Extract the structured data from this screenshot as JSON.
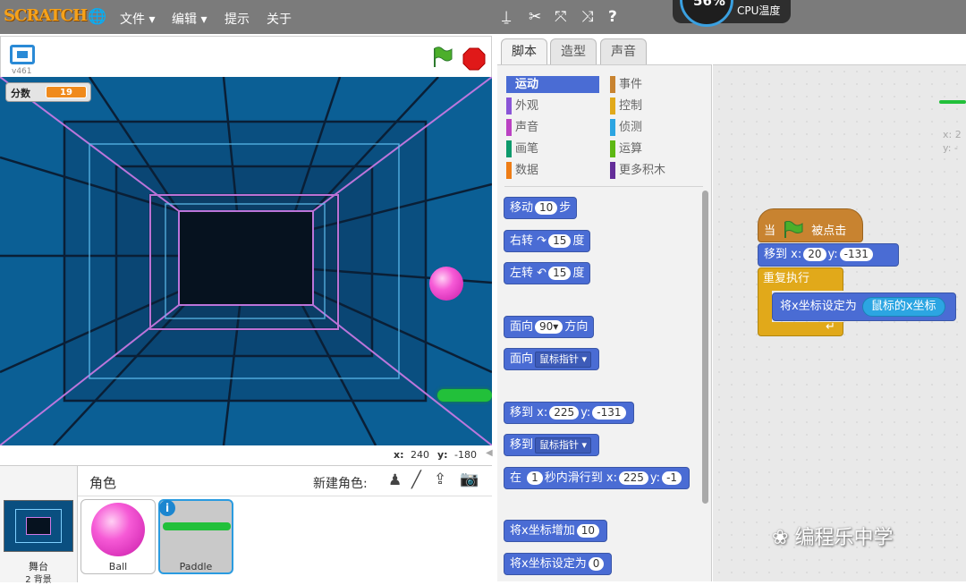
{
  "menubar": {
    "logo": "SCRATCH",
    "menu": [
      "文件 ▾",
      "编辑 ▾",
      "提示",
      "关于"
    ],
    "tools": [
      "stamp-icon",
      "scissors-icon",
      "grow-icon",
      "shrink-icon",
      "help-icon"
    ],
    "cpu": {
      "value": "56%",
      "label": "CPU温度"
    }
  },
  "stage": {
    "version": "v461",
    "score_label": "分数",
    "score_value": "19",
    "x_label": "x:",
    "x_value": "240",
    "y_label": "y:",
    "y_value": "-180",
    "ball_color": "#f040c8",
    "paddle_color": "#22c03a"
  },
  "sprites": {
    "header": "角色",
    "new_sprite": "新建角色:",
    "backdrop_label": "舞台",
    "backdrop_count": "2 背景",
    "items": [
      "Ball",
      "Paddle"
    ]
  },
  "tabs": [
    "脚本",
    "造型",
    "声音"
  ],
  "categories": {
    "left": [
      "运动",
      "外观",
      "声音",
      "画笔",
      "数据"
    ],
    "right": [
      "事件",
      "控制",
      "侦测",
      "运算",
      "更多积木"
    ],
    "left_colors": [
      "#4a6cd4",
      "#8a55d7",
      "#bb42c3",
      "#0e9a6c",
      "#ee7d16"
    ],
    "right_colors": [
      "#c88330",
      "#e1a91a",
      "#2ca5e2",
      "#5cb712",
      "#632d99"
    ]
  },
  "blocks": {
    "move": {
      "t1": "移动",
      "n": "10",
      "t2": "步"
    },
    "turn_right": {
      "t1": "右转",
      "n": "15",
      "t2": "度"
    },
    "turn_left": {
      "t1": "左转",
      "n": "15",
      "t2": "度"
    },
    "point_dir": {
      "t1": "面向",
      "n": "90▾",
      "t2": "方向"
    },
    "point_towards": {
      "t1": "面向",
      "d": "鼠标指针 ▾"
    },
    "goto_xy": {
      "t1": "移到 x:",
      "x": "225",
      "t2": "y:",
      "y": "-131"
    },
    "goto": {
      "t1": "移到",
      "d": "鼠标指针 ▾"
    },
    "glide": {
      "t1": "在",
      "n": "1",
      "t2": "秒内滑行到 x:",
      "x": "225",
      "t3": "y:",
      "y": "-1"
    },
    "change_x": {
      "t1": "将x坐标增加",
      "n": "10"
    },
    "set_x": {
      "t1": "将x坐标设定为",
      "n": "0"
    }
  },
  "script": {
    "hat_t1": "当",
    "hat_t2": "被点击",
    "goto_t1": "移到 x:",
    "goto_x": "20",
    "goto_t2": "y:",
    "goto_y": "-131",
    "forever": "重复执行",
    "setx": "将x坐标设定为",
    "reporter": "鼠标的x坐标",
    "coord_x": "x: 2",
    "coord_y": "y: -"
  },
  "watermark": "编程乐中学"
}
